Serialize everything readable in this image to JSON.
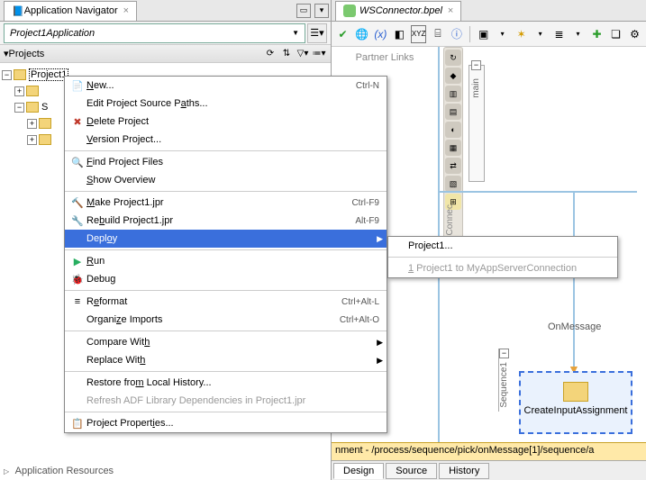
{
  "left": {
    "tab_title": "Application Navigator",
    "app_dropdown": "Project1Application",
    "projects_label": "Projects",
    "tree": {
      "root": "Project1",
      "app_resources": "Application Resources"
    }
  },
  "context_menu": {
    "new": "New...",
    "new_sc": "Ctrl-N",
    "edit_src": "Edit Project Source Paths...",
    "delete": "Delete Project",
    "version": "Version Project...",
    "find": "Find Project Files",
    "overview": "Show Overview",
    "make": "Make Project1.jpr",
    "make_sc": "Ctrl-F9",
    "rebuild": "Rebuild Project1.jpr",
    "rebuild_sc": "Alt-F9",
    "deploy": "Deploy",
    "run": "Run",
    "debug": "Debug",
    "reformat": "Reformat",
    "reformat_sc": "Ctrl+Alt-L",
    "organize": "Organize Imports",
    "organize_sc": "Ctrl+Alt-O",
    "compare": "Compare With",
    "replace": "Replace With",
    "restore": "Restore from Local History...",
    "refresh": "Refresh ADF Library Dependencies in Project1.jpr",
    "props": "Project Properties..."
  },
  "submenu": {
    "item1": "Project1...",
    "item2_num": "1",
    "item2_rest": " Project1 to MyAppServerConnection"
  },
  "right": {
    "tab": "WSConnector.bpel",
    "partner_links": "Partner Links",
    "main": "main",
    "wsconn": "WSConnec",
    "onmessage": "OnMessage",
    "sequence": "Sequence1",
    "assign": "CreateInputAssignment",
    "breadcrumb": "nment - /process/sequence/pick/onMessage[1]/sequence/a",
    "tabs": {
      "design": "Design",
      "source": "Source",
      "history": "History"
    }
  },
  "toolbar_glyphs": {
    "check": "✔",
    "globe": "🌐",
    "x": "(x)",
    "box": "◧",
    "xyz": "XYZ",
    "db": "⌸",
    "info": "ⓘ",
    "folder": "▣",
    "star": "✶",
    "doc": "≣",
    "new": "✚",
    "layers": "❏",
    "gear": "⚙"
  }
}
